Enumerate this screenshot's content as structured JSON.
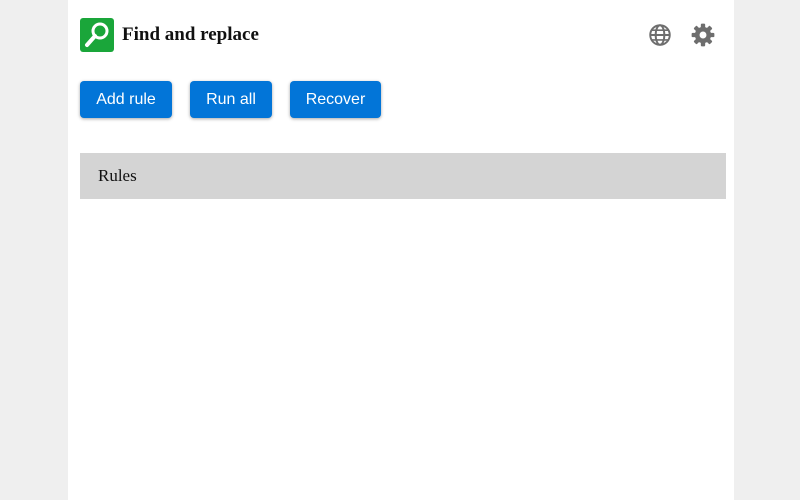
{
  "header": {
    "logo_icon": "search-icon",
    "logo_color": "#1aa63a",
    "title": "Find and replace",
    "language_icon": "globe-icon",
    "settings_icon": "gear-icon"
  },
  "actions": {
    "add_rule_label": "Add rule",
    "run_all_label": "Run all",
    "recover_label": "Recover",
    "button_color": "#0275d8"
  },
  "rules": {
    "heading": "Rules",
    "items": []
  }
}
